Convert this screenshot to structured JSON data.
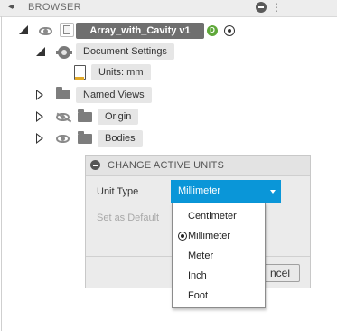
{
  "browser": {
    "title": "BROWSER",
    "collapse_glyph": "◂◂",
    "menu_glyph": "⋮"
  },
  "tree": {
    "root": {
      "label": "Array_with_Cavity v1",
      "badge": "D"
    },
    "document_settings": {
      "label": "Document Settings"
    },
    "units": {
      "label": "Units: mm"
    },
    "named_views": {
      "label": "Named Views"
    },
    "origin": {
      "label": "Origin"
    },
    "bodies": {
      "label": "Bodies"
    }
  },
  "dialog": {
    "title": "CHANGE ACTIVE UNITS",
    "unit_type_label": "Unit Type",
    "unit_type_value": "Millimeter",
    "set_default_label": "Set as Default",
    "cancel_label": "ncel"
  },
  "dropdown": {
    "options": [
      "Centimeter",
      "Millimeter",
      "Meter",
      "Inch",
      "Foot"
    ],
    "selected": "Millimeter"
  },
  "colors": {
    "accent": "#0a96d8",
    "panel": "#ebebeb",
    "badge": "#5fa83a"
  }
}
